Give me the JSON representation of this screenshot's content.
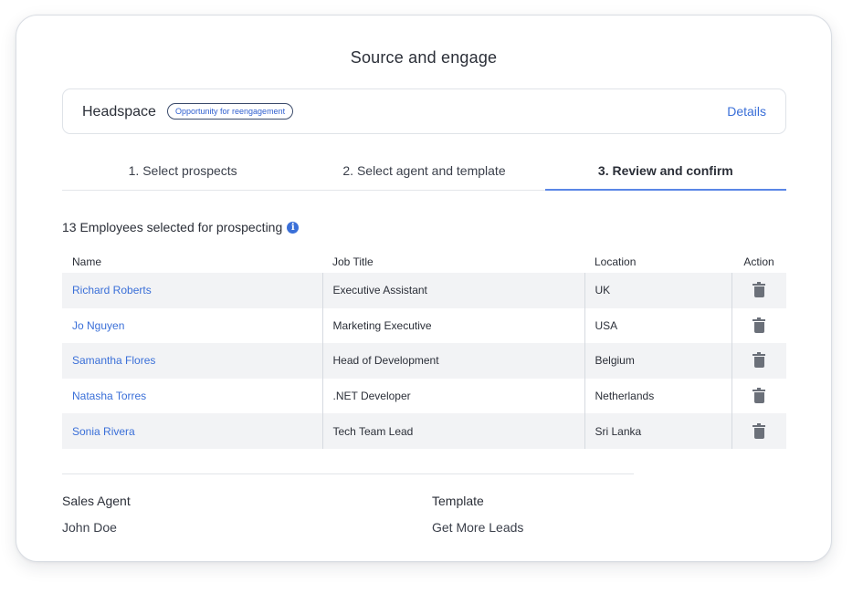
{
  "page": {
    "title": "Source and engage"
  },
  "company": {
    "name": "Headspace",
    "badge": "Opportunity for reengagement",
    "details_label": "Details"
  },
  "tabs": [
    {
      "label": "1. Select prospects",
      "active": false
    },
    {
      "label": "2. Select agent and template",
      "active": false
    },
    {
      "label": "3. Review and confirm",
      "active": true
    }
  ],
  "selection": {
    "summary": "13 Employees selected for prospecting",
    "info_icon": "info-icon"
  },
  "table": {
    "headers": {
      "name": "Name",
      "job_title": "Job Title",
      "location": "Location",
      "action": "Action"
    },
    "rows": [
      {
        "name": "Richard Roberts",
        "job_title": "Executive Assistant",
        "location": "UK",
        "action_icon": "trash-icon"
      },
      {
        "name": "Jo Nguyen",
        "job_title": "Marketing Executive",
        "location": "USA",
        "action_icon": "trash-icon"
      },
      {
        "name": "Samantha Flores",
        "job_title": "Head of Development",
        "location": "Belgium",
        "action_icon": "trash-icon"
      },
      {
        "name": "Natasha Torres",
        "job_title": ".NET Developer",
        "location": "Netherlands",
        "action_icon": "trash-icon"
      },
      {
        "name": "Sonia Rivera",
        "job_title": "Tech Team Lead",
        "location": "Sri Lanka",
        "action_icon": "trash-icon"
      }
    ]
  },
  "summary": {
    "sales_agent_label": "Sales Agent",
    "sales_agent_value": "John Doe",
    "template_label": "Template",
    "template_value": "Get More Leads"
  },
  "colors": {
    "accent": "#3a6fd8",
    "tab_underline": "#5a86e6",
    "row_stripe": "#f2f3f5"
  }
}
